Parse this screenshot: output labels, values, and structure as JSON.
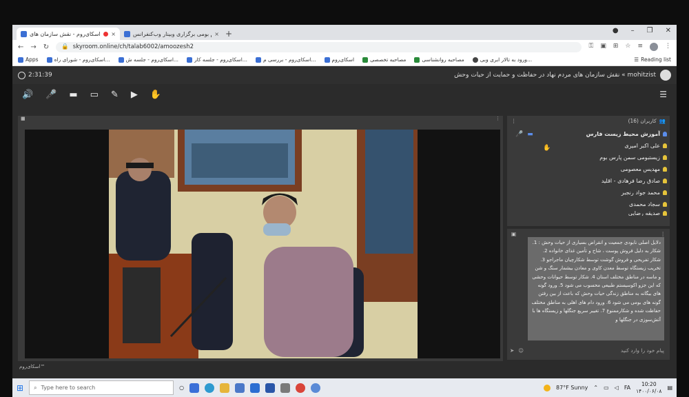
{
  "browser": {
    "tabs": [
      {
        "label": "اسکای‌روم - نقش سازمان های ..."
      },
      {
        "label": "پلتفرم بومی برگزاری وبینار وب‌کنفرانس"
      }
    ],
    "new_tab": "+",
    "url": "skyroom.online/ch/talab6002/amoozesh2",
    "bookmarks": [
      "Apps",
      "اسکای‌روم - شورای راه...",
      "اسکای‌روم - جلسه ش...",
      "اسکای‌روم - جلسه کار...",
      "اسکای‌روم - بررسی م...",
      "اسکای‌روم",
      "مصاحبه تخصصی",
      "مصاحبه روانشناسی",
      "ورود به تالار ابری وبی..."
    ],
    "reading_list": "Reading list"
  },
  "app": {
    "elapsed": "2:31:39",
    "room_title": "mohitzist » نقش سازمان های مردم نهاد در حفاظت و حمایت از حیات وحش"
  },
  "users_panel": {
    "title": "کاربران (16)",
    "users": [
      "آموزش محیط زیست فارس",
      "علی اکبر امیری",
      "زیستبومی سمن پارس بوم",
      "مهدیس معصومی",
      "صادق رضا فرهادی - اقلید",
      "محمد جواد رنجبر",
      "سجاد محمدی",
      "صدیقه رضایی"
    ]
  },
  "chat": {
    "message": "دلایل اصلی نابودی جمعیت و انقراض بسیاری از حیات وحش : 1. شکار به دلیل فروش پوست ، شاخ و تأمین غذای خانواده 2. شکار تفریحی و فروش گوشت توسط شکارچیان ماجراجو 3. تخریب زیستگاه توسط معدن کاوی و معادن بیشمار سنگ و شن و ماسه در مناطق مختلف استان 4. شکار توسط حیوانات وحشی که این جزو اکوسیستم طبیعی محسوب می شود 5. ورود گونه های بیگانه به مناطق زندگی حیات وحش که باعث از بین رفتن گونه های بومی می شود 6. ورود دام های اهلی به مناطق مختلف حفاظت شده و شکارممنوع 7. تغییر سریع جنگلها و زیستگاه ها با آتش‌سوزی در جنگلها و",
    "input_placeholder": "پیام خود را وارد کنید",
    "brand": "اسکای‌روم™"
  },
  "taskbar": {
    "search_placeholder": "Type here to search",
    "weather": "87°F  Sunny",
    "time": "10:20",
    "date": "۱۴۰۰/۰۶/۰۸",
    "lang": "FA"
  }
}
